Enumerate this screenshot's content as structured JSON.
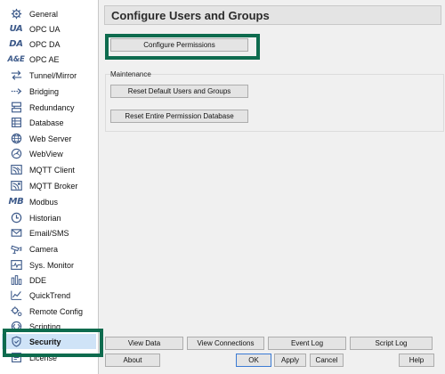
{
  "sidebar": {
    "items": [
      {
        "label": "General",
        "icon": "gear-icon"
      },
      {
        "label": "OPC UA",
        "icon_text": "UA"
      },
      {
        "label": "OPC DA",
        "icon_text": "DA"
      },
      {
        "label": "OPC AE",
        "icon_text": "A&E"
      },
      {
        "label": "Tunnel/Mirror",
        "icon": "tunnel-arrows-icon"
      },
      {
        "label": "Bridging",
        "icon": "bridging-arrow-icon"
      },
      {
        "label": "Redundancy",
        "icon": "redundancy-icon"
      },
      {
        "label": "Database",
        "icon": "database-icon"
      },
      {
        "label": "Web Server",
        "icon": "globe-icon"
      },
      {
        "label": "WebView",
        "icon": "webview-gauge-icon"
      },
      {
        "label": "MQTT Client",
        "icon": "mqtt-client-icon"
      },
      {
        "label": "MQTT Broker",
        "icon": "mqtt-broker-icon"
      },
      {
        "label": "Modbus",
        "icon_text": "MB"
      },
      {
        "label": "Historian",
        "icon": "clock-icon"
      },
      {
        "label": "Email/SMS",
        "icon": "email-icon"
      },
      {
        "label": "Camera",
        "icon": "camera-icon"
      },
      {
        "label": "Sys. Monitor",
        "icon": "monitor-icon"
      },
      {
        "label": "DDE",
        "icon": "dde-icon"
      },
      {
        "label": "QuickTrend",
        "icon": "trend-icon"
      },
      {
        "label": "Remote Config",
        "icon": "remote-config-icon"
      },
      {
        "label": "Scripting",
        "icon": "scripting-icon"
      },
      {
        "label": "Security",
        "icon": "shield-icon",
        "selected": true
      },
      {
        "label": "License",
        "icon": "license-icon"
      }
    ]
  },
  "main": {
    "title": "Configure Users and Groups",
    "configure_permissions": "Configure Permissions",
    "maintenance_label": "Maintenance",
    "reset_users": "Reset Default Users and Groups",
    "reset_db": "Reset Entire Permission Database"
  },
  "bottom": {
    "view_data": "View Data",
    "view_connections": "View Connections",
    "event_log": "Event Log",
    "script_log": "Script Log",
    "about": "About",
    "ok": "OK",
    "apply": "Apply",
    "cancel": "Cancel",
    "help": "Help"
  },
  "colors": {
    "highlight_box": "#0e6b4e",
    "selected_bg": "#cfe3f7",
    "icon": "#3d5a8a"
  }
}
